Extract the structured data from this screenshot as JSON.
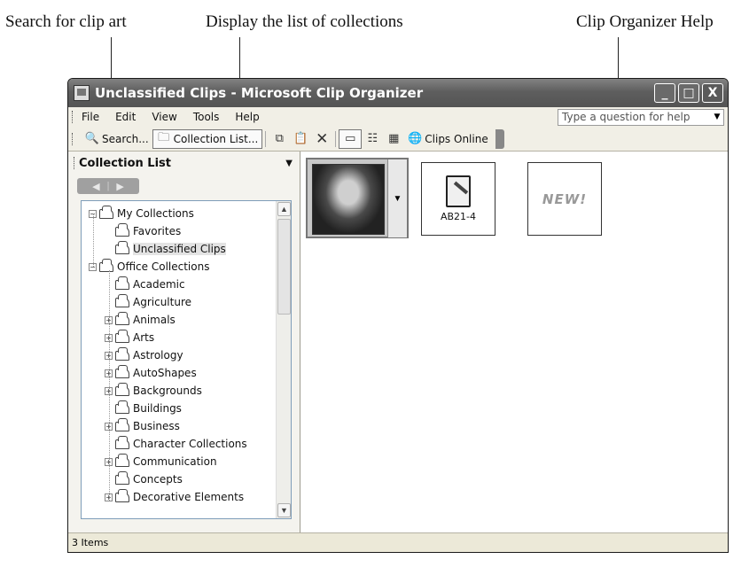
{
  "callouts": {
    "search": "Search for clip art",
    "collections": "Display the list of collections",
    "help": "Clip Organizer Help"
  },
  "window": {
    "title": "Unclassified Clips - Microsoft Clip Organizer",
    "minimize": "_",
    "maximize": "□",
    "close": "X"
  },
  "menu": {
    "items": [
      "File",
      "Edit",
      "View",
      "Tools",
      "Help"
    ],
    "help_placeholder": "Type a question for help"
  },
  "toolbar": {
    "search_label": "Search...",
    "collection_list_label": "Collection List...",
    "clips_online_label": "Clips Online"
  },
  "taskpane": {
    "title": "Collection List"
  },
  "tree": [
    {
      "label": "My Collections",
      "expander": "minus"
    },
    {
      "label": "Favorites",
      "expander": ""
    },
    {
      "label": "Unclassified Clips",
      "expander": "",
      "selected": true
    },
    {
      "label": "Office Collections",
      "expander": "minus"
    },
    {
      "label": "Academic",
      "expander": ""
    },
    {
      "label": "Agriculture",
      "expander": ""
    },
    {
      "label": "Animals",
      "expander": "plus"
    },
    {
      "label": "Arts",
      "expander": "plus"
    },
    {
      "label": "Astrology",
      "expander": "plus"
    },
    {
      "label": "AutoShapes",
      "expander": "plus"
    },
    {
      "label": "Backgrounds",
      "expander": "plus"
    },
    {
      "label": "Buildings",
      "expander": ""
    },
    {
      "label": "Business",
      "expander": "plus"
    },
    {
      "label": "Character Collections",
      "expander": ""
    },
    {
      "label": "Communication",
      "expander": "plus"
    },
    {
      "label": "Concepts",
      "expander": ""
    },
    {
      "label": "Decorative Elements",
      "expander": "plus"
    }
  ],
  "clips": {
    "doc_label": "AB21-4",
    "new_label": "NEW!"
  },
  "status": {
    "text": "3 Items"
  }
}
